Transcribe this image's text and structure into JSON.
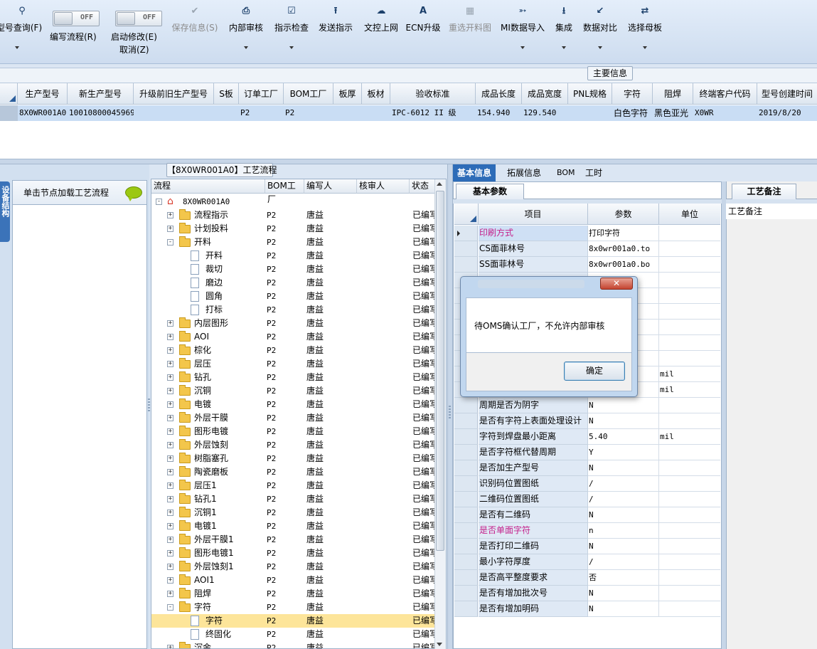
{
  "toolbar": {
    "buttons": [
      {
        "label": "型号查询(F)",
        "icon": "search-icon"
      },
      {
        "label": "保存信息(S)",
        "icon": "check-icon",
        "disabled": true
      },
      {
        "label": "内部审核",
        "icon": "printer-icon"
      },
      {
        "label": "指示检查",
        "icon": "checkbox-icon"
      },
      {
        "label": "发送指示",
        "icon": "upload-icon"
      },
      {
        "label": "文控上网",
        "icon": "cloud-upload-icon"
      },
      {
        "label": "ECN升级",
        "icon": "font-a-icon"
      },
      {
        "label": "重选开料图",
        "icon": "image-icon",
        "disabled": true
      },
      {
        "label": "MI数据导入",
        "icon": "import-icon"
      },
      {
        "label": "集成",
        "icon": "download-icon"
      },
      {
        "label": "数据对比",
        "icon": "compress-icon"
      },
      {
        "label": "选择母板",
        "icon": "shuffle-icon"
      }
    ],
    "toggles": [
      {
        "label": "编写流程(R)",
        "state": "OFF"
      },
      {
        "label": "启动修改(E)",
        "label2": "取消(Z)",
        "state": "OFF"
      }
    ]
  },
  "strip": {
    "tab": "主要信息"
  },
  "grid": {
    "columns": [
      "生产型号",
      "新生产型号",
      "升级前旧生产型号",
      "S板",
      "订单工厂",
      "BOM工厂",
      "板厚",
      "板材",
      "验收标准",
      "成品长度",
      "成品宽度",
      "PNL规格",
      "字符",
      "阻焊",
      "终端客户代码",
      "型号创建时间"
    ],
    "row": [
      "8X0WR001A0",
      "10010800045969",
      "",
      "",
      "P2",
      "P2",
      "",
      "",
      "IPC-6012 II 级",
      "154.940",
      "129.540",
      "",
      "白色字符",
      "黑色亚光",
      "X0WR",
      "2019/8/20"
    ]
  },
  "left": {
    "vtab": "设备结构",
    "header": "单击节点加载工艺流程"
  },
  "tree": {
    "title": "【8X0WR001A0】工艺流程",
    "columns": [
      "流程",
      "BOM工厂",
      "编写人",
      "核审人",
      "状态"
    ],
    "root": "8X0WR001A0",
    "rows": [
      {
        "name": "流程指示",
        "level": 1,
        "exp": "+",
        "bom": "P2",
        "writer": "唐益",
        "status": "已编写"
      },
      {
        "name": "计划投料",
        "level": 1,
        "exp": "+",
        "bom": "P2",
        "writer": "唐益",
        "status": "已编写"
      },
      {
        "name": "开料",
        "level": 1,
        "exp": "-",
        "bom": "P2",
        "writer": "唐益",
        "status": "已编写"
      },
      {
        "name": "开料",
        "level": 2,
        "bom": "P2",
        "writer": "唐益",
        "status": "已编写"
      },
      {
        "name": "裁切",
        "level": 2,
        "bom": "P2",
        "writer": "唐益",
        "status": "已编写"
      },
      {
        "name": "磨边",
        "level": 2,
        "bom": "P2",
        "writer": "唐益",
        "status": "已编写"
      },
      {
        "name": "圆角",
        "level": 2,
        "bom": "P2",
        "writer": "唐益",
        "status": "已编写"
      },
      {
        "name": "打标",
        "level": 2,
        "bom": "P2",
        "writer": "唐益",
        "status": "已编写"
      },
      {
        "name": "内层图形",
        "level": 1,
        "exp": "+",
        "bom": "P2",
        "writer": "唐益",
        "status": "已编写"
      },
      {
        "name": "AOI",
        "level": 1,
        "exp": "+",
        "bom": "P2",
        "writer": "唐益",
        "status": "已编写"
      },
      {
        "name": "棕化",
        "level": 1,
        "exp": "+",
        "bom": "P2",
        "writer": "唐益",
        "status": "已编写"
      },
      {
        "name": "层压",
        "level": 1,
        "exp": "+",
        "bom": "P2",
        "writer": "唐益",
        "status": "已编写"
      },
      {
        "name": "钻孔",
        "level": 1,
        "exp": "+",
        "bom": "P2",
        "writer": "唐益",
        "status": "已编写"
      },
      {
        "name": "沉铜",
        "level": 1,
        "exp": "+",
        "bom": "P2",
        "writer": "唐益",
        "status": "已编写"
      },
      {
        "name": "电镀",
        "level": 1,
        "exp": "+",
        "bom": "P2",
        "writer": "唐益",
        "status": "已编写"
      },
      {
        "name": "外层干膜",
        "level": 1,
        "exp": "+",
        "bom": "P2",
        "writer": "唐益",
        "status": "已编写"
      },
      {
        "name": "图形电镀",
        "level": 1,
        "exp": "+",
        "bom": "P2",
        "writer": "唐益",
        "status": "已编写"
      },
      {
        "name": "外层蚀刻",
        "level": 1,
        "exp": "+",
        "bom": "P2",
        "writer": "唐益",
        "status": "已编写"
      },
      {
        "name": "树脂塞孔",
        "level": 1,
        "exp": "+",
        "bom": "P2",
        "writer": "唐益",
        "status": "已编写"
      },
      {
        "name": "陶瓷磨板",
        "level": 1,
        "exp": "+",
        "bom": "P2",
        "writer": "唐益",
        "status": "已编写"
      },
      {
        "name": "层压1",
        "level": 1,
        "exp": "+",
        "bom": "P2",
        "writer": "唐益",
        "status": "已编写"
      },
      {
        "name": "钻孔1",
        "level": 1,
        "exp": "+",
        "bom": "P2",
        "writer": "唐益",
        "status": "已编写"
      },
      {
        "name": "沉铜1",
        "level": 1,
        "exp": "+",
        "bom": "P2",
        "writer": "唐益",
        "status": "已编写"
      },
      {
        "name": "电镀1",
        "level": 1,
        "exp": "+",
        "bom": "P2",
        "writer": "唐益",
        "status": "已编写"
      },
      {
        "name": "外层干膜1",
        "level": 1,
        "exp": "+",
        "bom": "P2",
        "writer": "唐益",
        "status": "已编写"
      },
      {
        "name": "图形电镀1",
        "level": 1,
        "exp": "+",
        "bom": "P2",
        "writer": "唐益",
        "status": "已编写"
      },
      {
        "name": "外层蚀刻1",
        "level": 1,
        "exp": "+",
        "bom": "P2",
        "writer": "唐益",
        "status": "已编写"
      },
      {
        "name": "AOI1",
        "level": 1,
        "exp": "+",
        "bom": "P2",
        "writer": "唐益",
        "status": "已编写"
      },
      {
        "name": "阻焊",
        "level": 1,
        "exp": "+",
        "bom": "P2",
        "writer": "唐益",
        "status": "已编写"
      },
      {
        "name": "字符",
        "level": 1,
        "exp": "-",
        "bom": "P2",
        "writer": "唐益",
        "status": "已编写"
      },
      {
        "name": "字符",
        "level": 2,
        "bom": "P2",
        "writer": "唐益",
        "status": "已编写",
        "selected": true
      },
      {
        "name": "终固化",
        "level": 2,
        "bom": "P2",
        "writer": "唐益",
        "status": "已编写"
      },
      {
        "name": "沉金",
        "level": 1,
        "exp": "+",
        "bom": "P2",
        "writer": "唐益",
        "status": "已编写"
      }
    ]
  },
  "right": {
    "tabs": [
      "基本信息",
      "拓展信息",
      "BOM",
      "工时"
    ],
    "subtab": "基本参数",
    "columns": [
      "项目",
      "参数",
      "单位"
    ],
    "rows": [
      {
        "item": "印刷方式",
        "value": "打印字符",
        "unit": "",
        "pink": true,
        "current": true
      },
      {
        "item": "CS面菲林号",
        "value": "8x0wr001a0.to",
        "unit": ""
      },
      {
        "item": "SS面菲林号",
        "value": "8x0wr001a0.bo",
        "unit": ""
      },
      {
        "item": "",
        "value": "",
        "unit": ""
      },
      {
        "item": "",
        "value": "",
        "unit": ""
      },
      {
        "item": "",
        "value": "",
        "unit": ""
      },
      {
        "item": "",
        "value": "",
        "unit": ""
      },
      {
        "item": "",
        "value": "",
        "unit": ""
      },
      {
        "item": "",
        "value": "",
        "unit": ""
      },
      {
        "item": "",
        "value": "",
        "unit": "mil"
      },
      {
        "item": "",
        "value": "",
        "unit": "mil"
      },
      {
        "item": "周期是否为阴字",
        "value": "N",
        "unit": ""
      },
      {
        "item": "是否有字符上表面处理设计",
        "value": "N",
        "unit": ""
      },
      {
        "item": "字符到焊盘最小距离",
        "value": "5.40",
        "unit": "mil"
      },
      {
        "item": "是否字符框代替周期",
        "value": "Y",
        "unit": ""
      },
      {
        "item": "是否加生产型号",
        "value": "N",
        "unit": ""
      },
      {
        "item": "识别码位置图纸",
        "value": "/",
        "unit": ""
      },
      {
        "item": "二维码位置图纸",
        "value": "/",
        "unit": ""
      },
      {
        "item": "是否有二维码",
        "value": "N",
        "unit": ""
      },
      {
        "item": "是否单面字符",
        "value": "n",
        "unit": "",
        "pink": true
      },
      {
        "item": "是否打印二维码",
        "value": "N",
        "unit": ""
      },
      {
        "item": "最小字符厚度",
        "value": "/",
        "unit": ""
      },
      {
        "item": "是否高平整度要求",
        "value": "否",
        "unit": ""
      },
      {
        "item": "是否有增加批次号",
        "value": "N",
        "unit": ""
      },
      {
        "item": "是否有增加明码",
        "value": "N",
        "unit": ""
      }
    ],
    "note_tab": "工艺备注",
    "note_header": "工艺备注"
  },
  "dialog": {
    "message": "待OMS确认工厂，不允许内部审核",
    "ok_label": "确定",
    "close_glyph": "✕"
  }
}
